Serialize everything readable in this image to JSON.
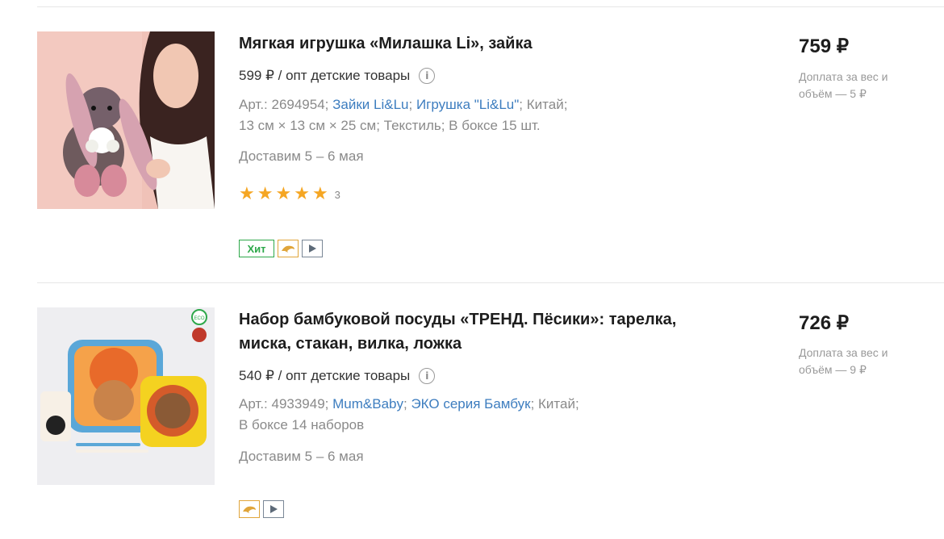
{
  "products": [
    {
      "title": "Мягкая игрушка «Милашка Li», зайка",
      "wholesale": "599 ₽ / опт детские товары",
      "art_prefix": "Арт.: 2694954; ",
      "link1": "Зайки Li&Lu",
      "sep1": "; ",
      "link2": "Игрушка \"Li&Lu\"",
      "meta_rest": "; Китай;",
      "meta_line2": "13 см × 13 см × 25 см; Текстиль; В боксе 15 шт.",
      "delivery": "Доставим 5 – 6 мая",
      "rating_stars": 5,
      "rating_count": "3",
      "badge_hit": "Хит",
      "price": "759 ₽",
      "surcharge": "Доплата за вес и объём — 5 ₽"
    },
    {
      "title": "Набор бамбуковой посуды «ТРЕНД. Пёсики»: тарелка, миска, стакан, вилка, ложка",
      "wholesale": "540 ₽ / опт детские товары",
      "art_prefix": "Арт.: 4933949; ",
      "link1": "Mum&Baby",
      "sep1": "; ",
      "link2": "ЭКО серия Бамбук",
      "meta_rest": "; Китай;",
      "meta_line2": "В боксе 14 наборов",
      "delivery": "Доставим 5 – 6 мая",
      "price": "726 ₽",
      "surcharge": "Доплата за вес и объём — 9 ₽",
      "eco_label": "ECO"
    }
  ],
  "colors": {
    "link": "#3d7dbf",
    "hit": "#2ea84a",
    "star": "#f5a623",
    "muted": "#8a8a8a"
  },
  "icons": {
    "info": "info-icon",
    "star": "star-icon",
    "dolphin": "dolphin-icon",
    "play": "play-icon"
  }
}
